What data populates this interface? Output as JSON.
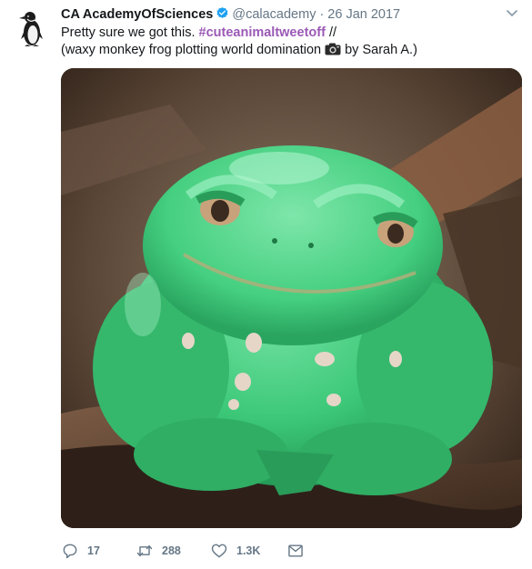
{
  "tweet": {
    "display_name": "CA AcademyOfSciences",
    "handle": "@calacademy",
    "separator": "·",
    "date": "26 Jan 2017",
    "text_line1_prefix": "Pretty sure we got this. ",
    "hashtag": "#cuteanimaltweetoff",
    "text_line1_suffix": " //",
    "text_line2_prefix": "(waxy monkey frog plotting world domination",
    "text_line2_suffix": "by Sarah A.)",
    "verified": true
  },
  "actions": {
    "reply_count": "17",
    "retweet_count": "288",
    "like_count": "1.3K"
  },
  "icons": {
    "avatar": "penguin-avatar-icon",
    "verified": "verified-badge-icon",
    "camera": "camera-icon",
    "caret": "chevron-down-icon",
    "reply": "reply-icon",
    "retweet": "retweet-icon",
    "like": "heart-icon",
    "dm": "envelope-icon"
  },
  "colors": {
    "hashtag": "#9b59b6",
    "verified": "#1da1f2",
    "muted": "#657786",
    "text": "#14171a"
  }
}
